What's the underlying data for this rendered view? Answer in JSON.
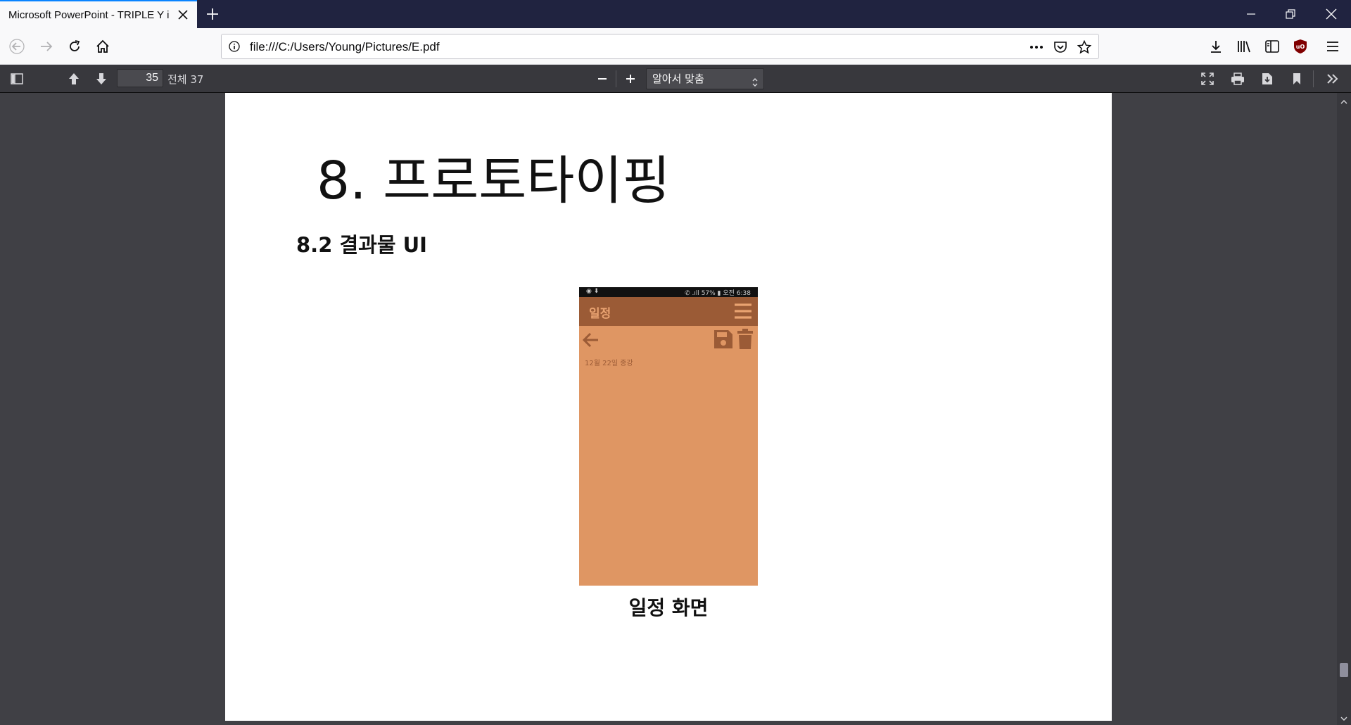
{
  "browser": {
    "tab_title": "Microsoft PowerPoint - TRIPLE Y i",
    "url": "file:///C:/Users/Young/Pictures/E.pdf"
  },
  "pdf_toolbar": {
    "page_number": "35",
    "page_total": "전체 37",
    "zoom_option": "알아서 맞춤"
  },
  "slide": {
    "title": "8. 프로토타이핑",
    "subtitle": "8.2 결과물 UI",
    "caption": "일정 화면",
    "phone": {
      "status_right": "✆ .ıll 57% ▮ 오전 6:38",
      "app_title": "일정",
      "note_text": "12월 22일 종강",
      "colors": {
        "background": "#df9663",
        "appbar": "#9b5b36",
        "title": "#e9a371"
      }
    }
  },
  "icons": {
    "back": "arrow-left-icon",
    "forward": "arrow-right-icon",
    "reload": "reload-icon",
    "home": "home-icon",
    "save": "floppy-disk-icon",
    "trash": "trash-icon",
    "menu": "hamburger-icon"
  }
}
